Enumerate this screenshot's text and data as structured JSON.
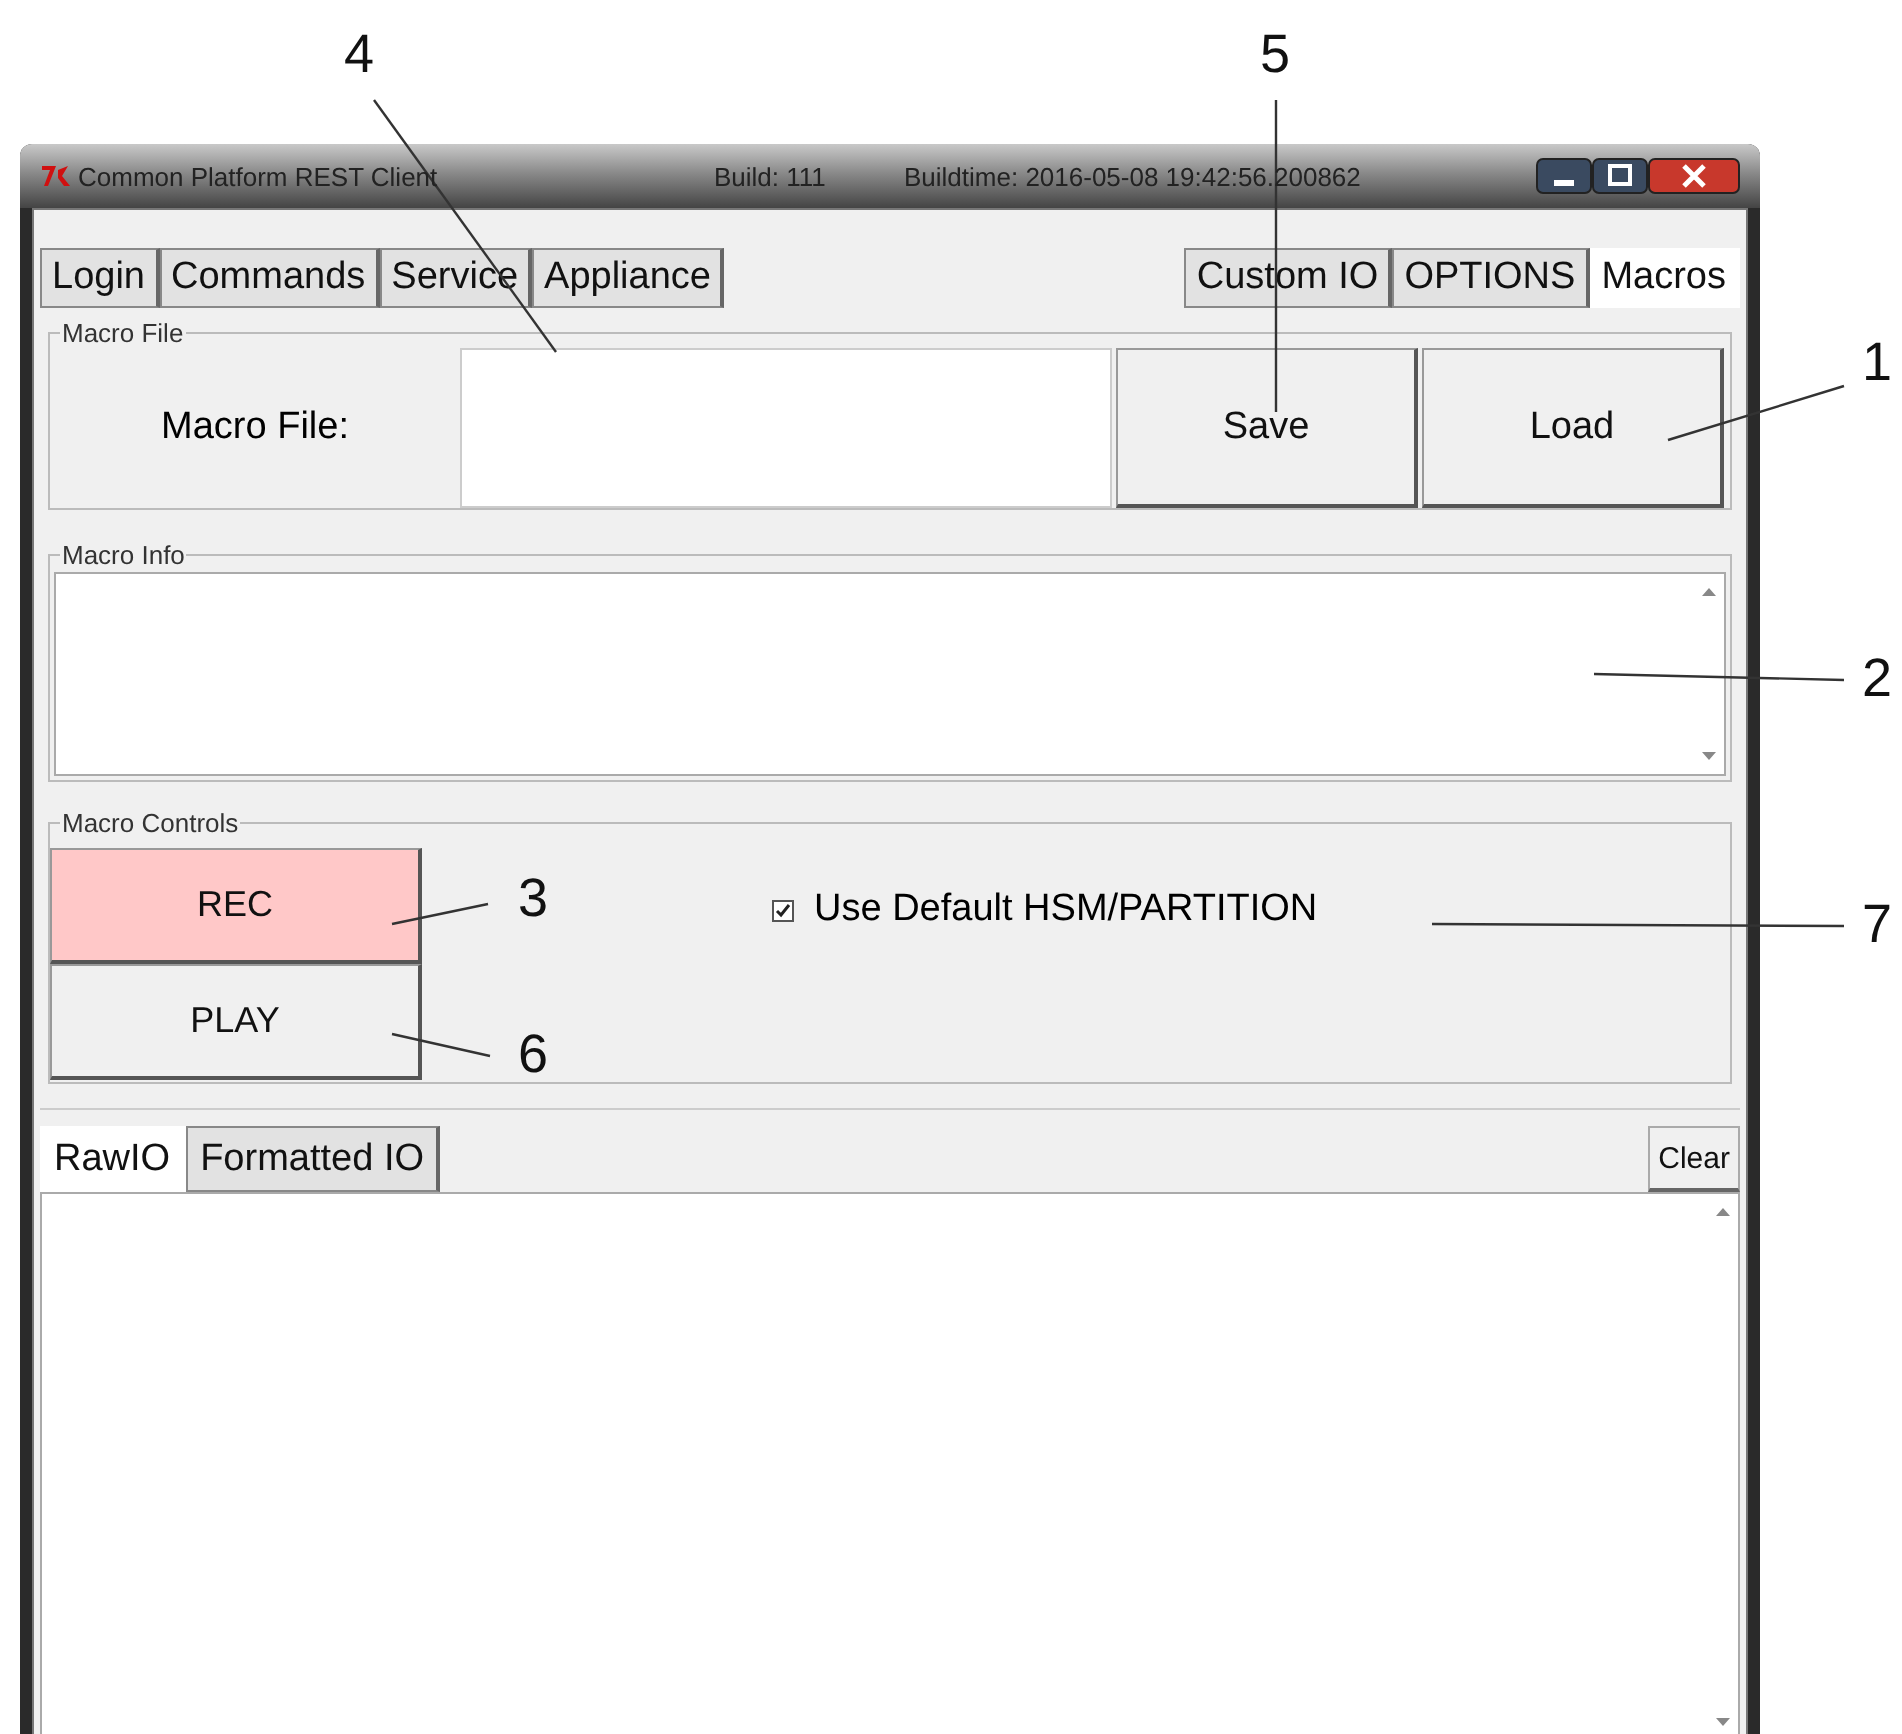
{
  "window": {
    "title": "Common Platform REST Client",
    "build": "Build: 111",
    "buildtime": "Buildtime: 2016-05-08 19:42:56.200862"
  },
  "tabs_left": [
    {
      "label": "Login",
      "selected": false
    },
    {
      "label": "Commands",
      "selected": false
    },
    {
      "label": "Service",
      "selected": false
    },
    {
      "label": "Appliance",
      "selected": false
    }
  ],
  "tabs_right": [
    {
      "label": "Custom IO",
      "selected": false
    },
    {
      "label": "OPTIONS",
      "selected": false
    },
    {
      "label": "Macros",
      "selected": true
    }
  ],
  "macro_file": {
    "legend": "Macro File",
    "label": "Macro File:",
    "buttons": [
      "Save",
      "Load"
    ]
  },
  "macro_info": {
    "legend": "Macro Info"
  },
  "macro_controls": {
    "legend": "Macro Controls",
    "buttons": [
      {
        "label": "REC",
        "color": "#ffc8c8"
      },
      {
        "label": "PLAY",
        "color": "#f0f0f0"
      }
    ],
    "checkbox": {
      "label": "Use Default HSM/PARTITION",
      "checked": true
    }
  },
  "io_tabs": [
    {
      "label": "RawIO",
      "selected": true
    },
    {
      "label": "Formatted IO",
      "selected": false
    }
  ],
  "clear_button": "Clear",
  "callouts": [
    "4",
    "5",
    "1",
    "2",
    "3",
    "6",
    "7"
  ]
}
